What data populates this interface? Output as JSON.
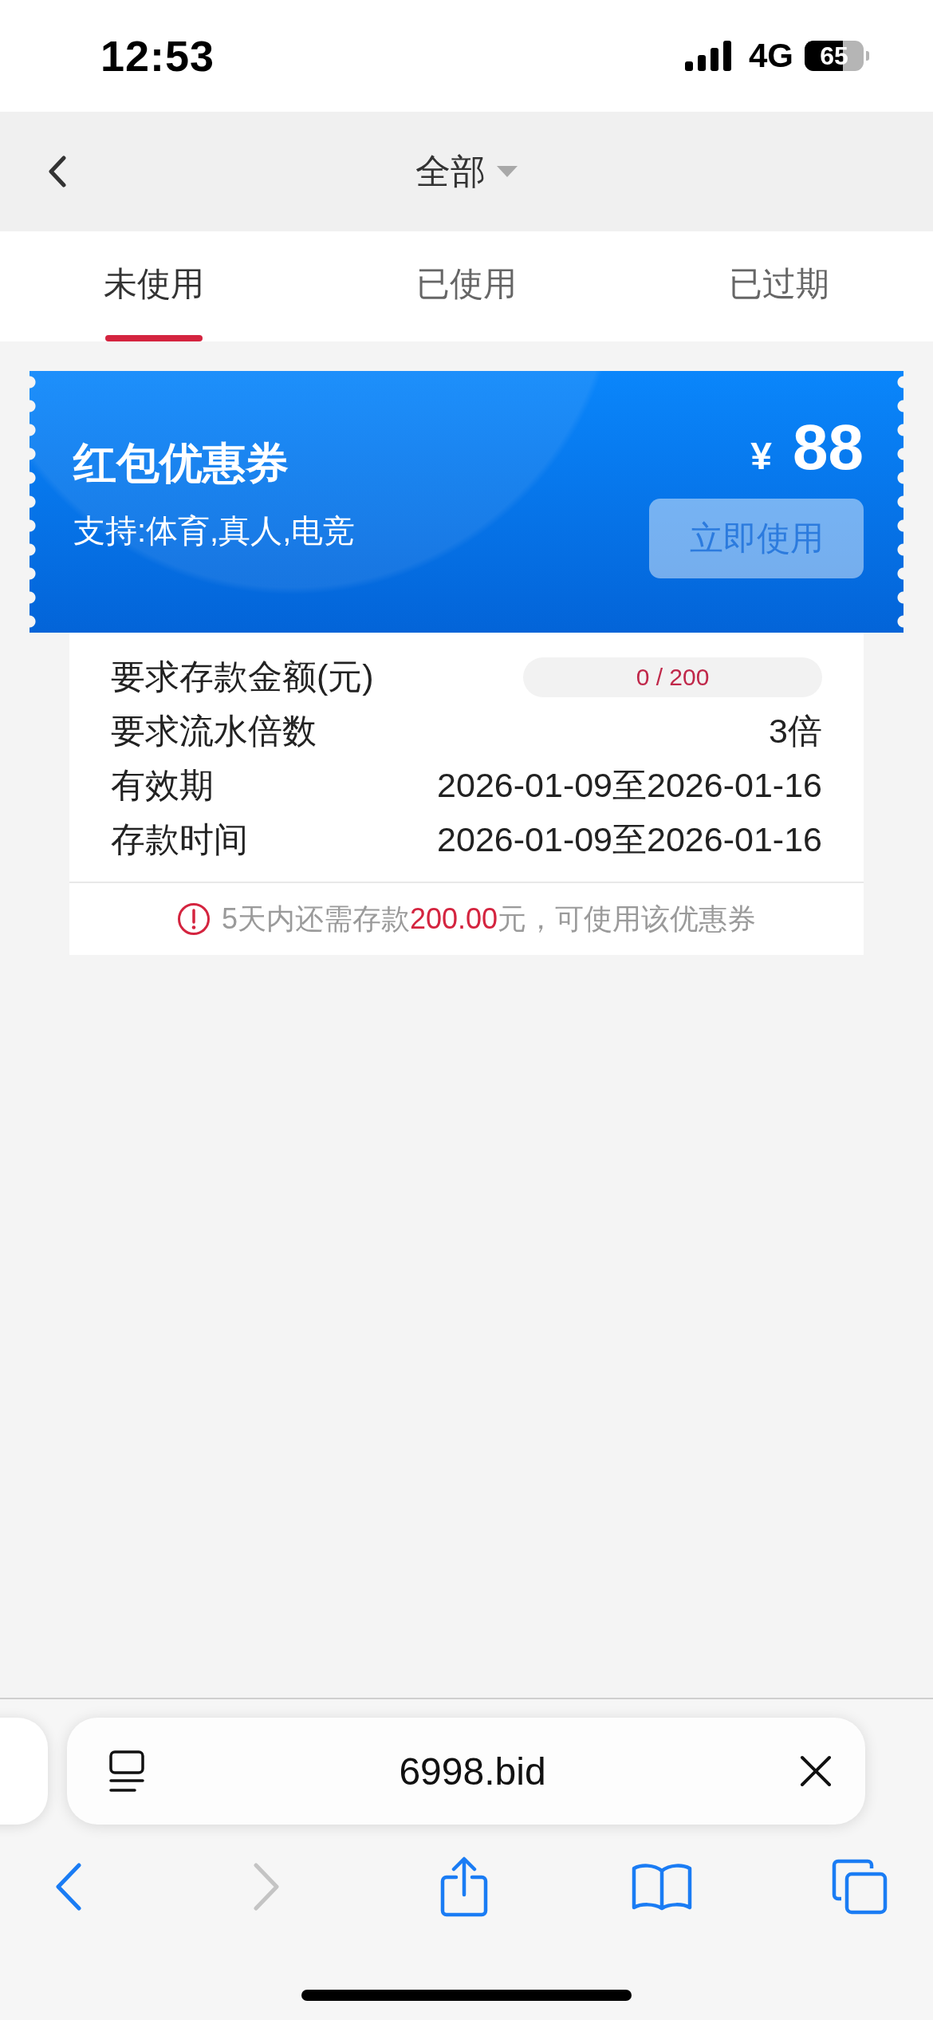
{
  "status_bar": {
    "time": "12:53",
    "network": "4G",
    "battery": "65"
  },
  "nav": {
    "title": "全部"
  },
  "tabs": [
    {
      "label": "未使用",
      "selected": true
    },
    {
      "label": "已使用",
      "selected": false
    },
    {
      "label": "已过期",
      "selected": false
    }
  ],
  "coupon": {
    "title": "红包优惠券",
    "support": "支持:体育,真人,电竞",
    "currency": "¥",
    "amount": "88",
    "button": {
      "label": "立即使用",
      "disabled": true
    }
  },
  "details": {
    "deposit": {
      "label": "要求存款金额(元)",
      "progress": "0 / 200",
      "level": 0
    },
    "rows": [
      {
        "label": "要求流水倍数",
        "value": "3倍"
      },
      {
        "label": "有效期",
        "value": "2026-01-09至2026-01-16"
      },
      {
        "label": "存款时间",
        "value": "2026-01-09至2026-01-16"
      }
    ],
    "notice": [
      {
        "text": "5天内还需存款",
        "highlight": false
      },
      {
        "text": "200.00",
        "highlight": true
      },
      {
        "text": "元，可使用该优惠券",
        "highlight": false
      }
    ]
  },
  "browser": {
    "url": "6998.bid",
    "back": {
      "disabled": false
    },
    "forward": {
      "disabled": true
    }
  }
}
